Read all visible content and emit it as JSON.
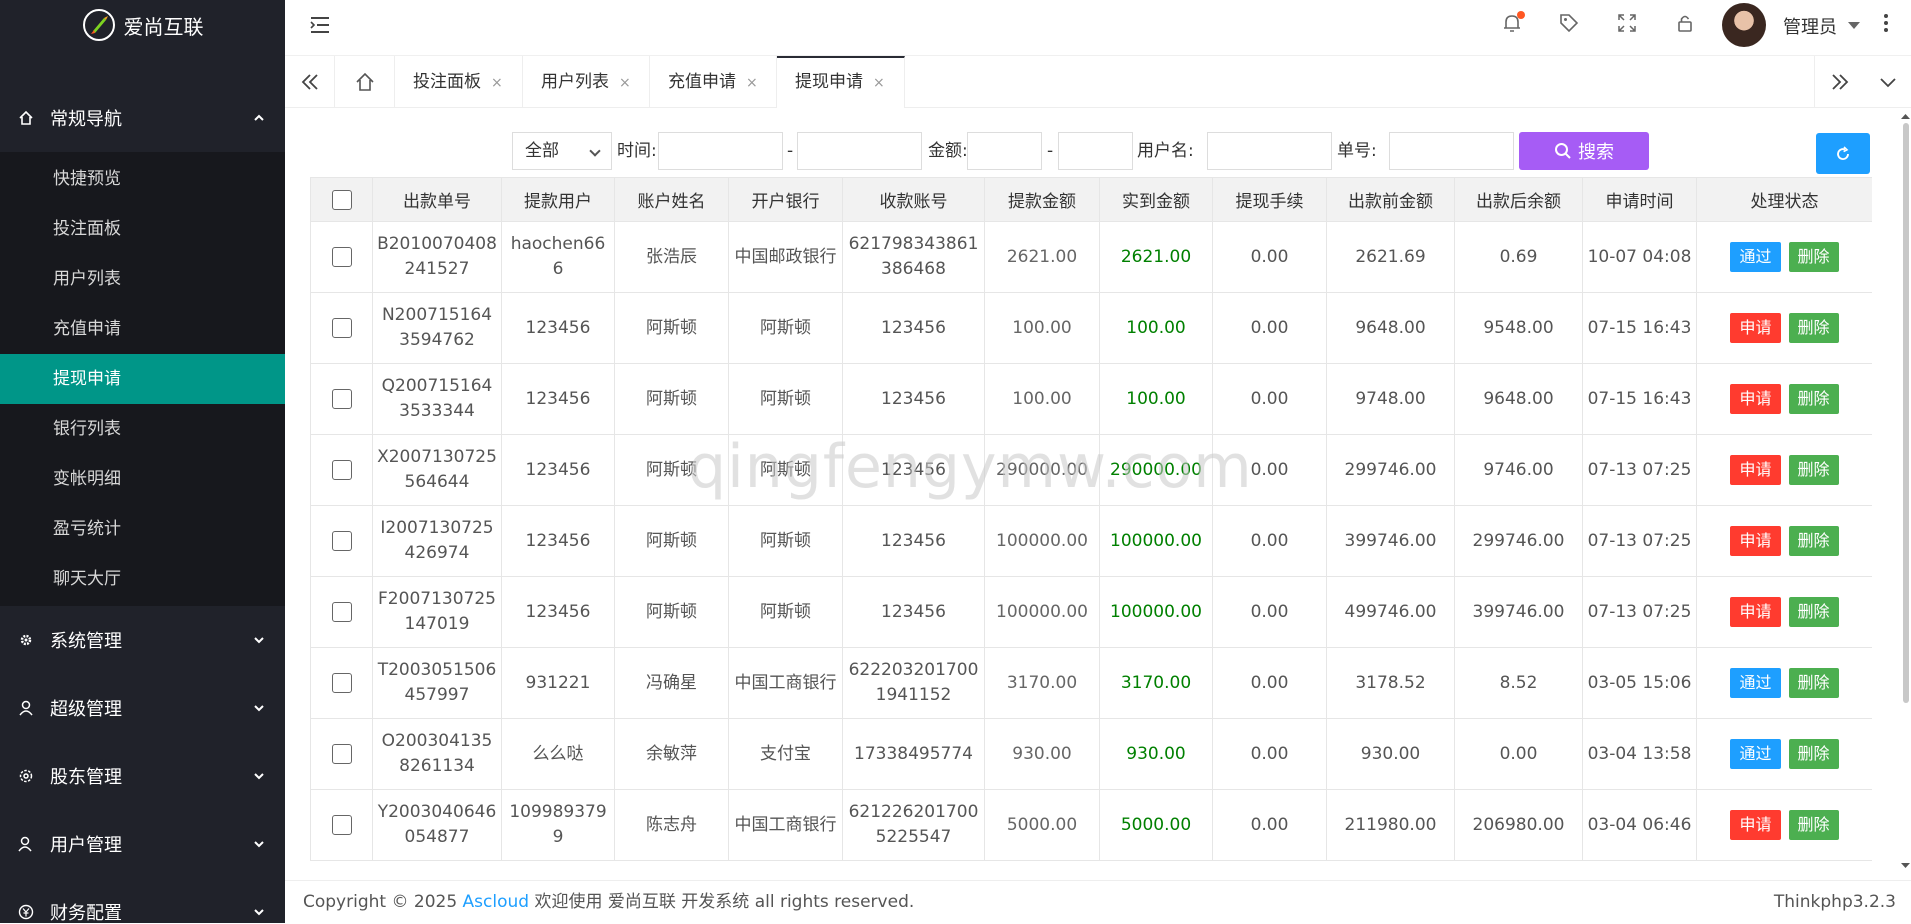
{
  "app": {
    "logo_text": "爱尚互联"
  },
  "sidebar": {
    "main_group": "常规导航",
    "items": [
      "快捷预览",
      "投注面板",
      "用户列表",
      "充值申请",
      "提现申请",
      "银行列表",
      "变帐明细",
      "盈亏统计",
      "聊天大厅"
    ],
    "active_index": 4,
    "groups": [
      "系统管理",
      "超级管理",
      "股东管理",
      "用户管理",
      "财务配置"
    ]
  },
  "header": {
    "user_name": "管理员"
  },
  "tabs": [
    {
      "label": "投注面板",
      "close": "×"
    },
    {
      "label": "用户列表",
      "close": "×"
    },
    {
      "label": "充值申请",
      "close": "×"
    },
    {
      "label": "提现申请",
      "close": "×"
    }
  ],
  "search": {
    "status_selected": "全部",
    "time_label": "时间:",
    "dash": "-",
    "amount_label": "金额:",
    "username_label": "用户名:",
    "order_label": "单号:",
    "search_button": "搜索"
  },
  "table": {
    "headers": [
      "出款单号",
      "提款用户",
      "账户姓名",
      "开户银行",
      "收款账号",
      "提款金额",
      "实到金额",
      "提现手续",
      "出款前金额",
      "出款后余额",
      "申请时间",
      "处理状态"
    ],
    "rows": [
      [
        "B2010070408241527",
        "haochen666",
        "张浩辰",
        "中国邮政银行",
        "621798343861386468",
        "2621.00",
        "2621.00",
        "0.00",
        "2621.69",
        "0.69",
        "10-07 04:08",
        "通过",
        "删除"
      ],
      [
        "N2007151643594762",
        "123456",
        "阿斯顿",
        "阿斯顿",
        "123456",
        "100.00",
        "100.00",
        "0.00",
        "9648.00",
        "9548.00",
        "07-15 16:43",
        "申请",
        "删除"
      ],
      [
        "Q2007151643533344",
        "123456",
        "阿斯顿",
        "阿斯顿",
        "123456",
        "100.00",
        "100.00",
        "0.00",
        "9748.00",
        "9648.00",
        "07-15 16:43",
        "申请",
        "删除"
      ],
      [
        "X2007130725564644",
        "123456",
        "阿斯顿",
        "阿斯顿",
        "123456",
        "290000.00",
        "290000.00",
        "0.00",
        "299746.00",
        "9746.00",
        "07-13 07:25",
        "申请",
        "删除"
      ],
      [
        "I2007130725426974",
        "123456",
        "阿斯顿",
        "阿斯顿",
        "123456",
        "100000.00",
        "100000.00",
        "0.00",
        "399746.00",
        "299746.00",
        "07-13 07:25",
        "申请",
        "删除"
      ],
      [
        "F2007130725147019",
        "123456",
        "阿斯顿",
        "阿斯顿",
        "123456",
        "100000.00",
        "100000.00",
        "0.00",
        "499746.00",
        "399746.00",
        "07-13 07:25",
        "申请",
        "删除"
      ],
      [
        "T2003051506457997",
        "931221",
        "冯确星",
        "中国工商银行",
        "6222032017001941152",
        "3170.00",
        "3170.00",
        "0.00",
        "3178.52",
        "8.52",
        "03-05 15:06",
        "通过",
        "删除"
      ],
      [
        "O2003041358261134",
        "么么哒",
        "余敏萍",
        "支付宝",
        "17338495774",
        "930.00",
        "930.00",
        "0.00",
        "930.00",
        "0.00",
        "03-04 13:58",
        "通过",
        "删除"
      ],
      [
        "Y2003040646054877",
        "1099893799",
        "陈志舟",
        "中国工商银行",
        "6212262017005225547",
        "5000.00",
        "5000.00",
        "0.00",
        "211980.00",
        "206980.00",
        "03-04 06:46",
        "申请",
        "删除"
      ]
    ]
  },
  "footer": {
    "copyright_prefix": "Copyright © 2025",
    "link": "Ascloud",
    "copyright_suffix": "欢迎使用 爱尚互联 开发系统 all rights reserved.",
    "version": "Thinkphp3.2.3"
  },
  "watermark": "qingfengymw.com"
}
